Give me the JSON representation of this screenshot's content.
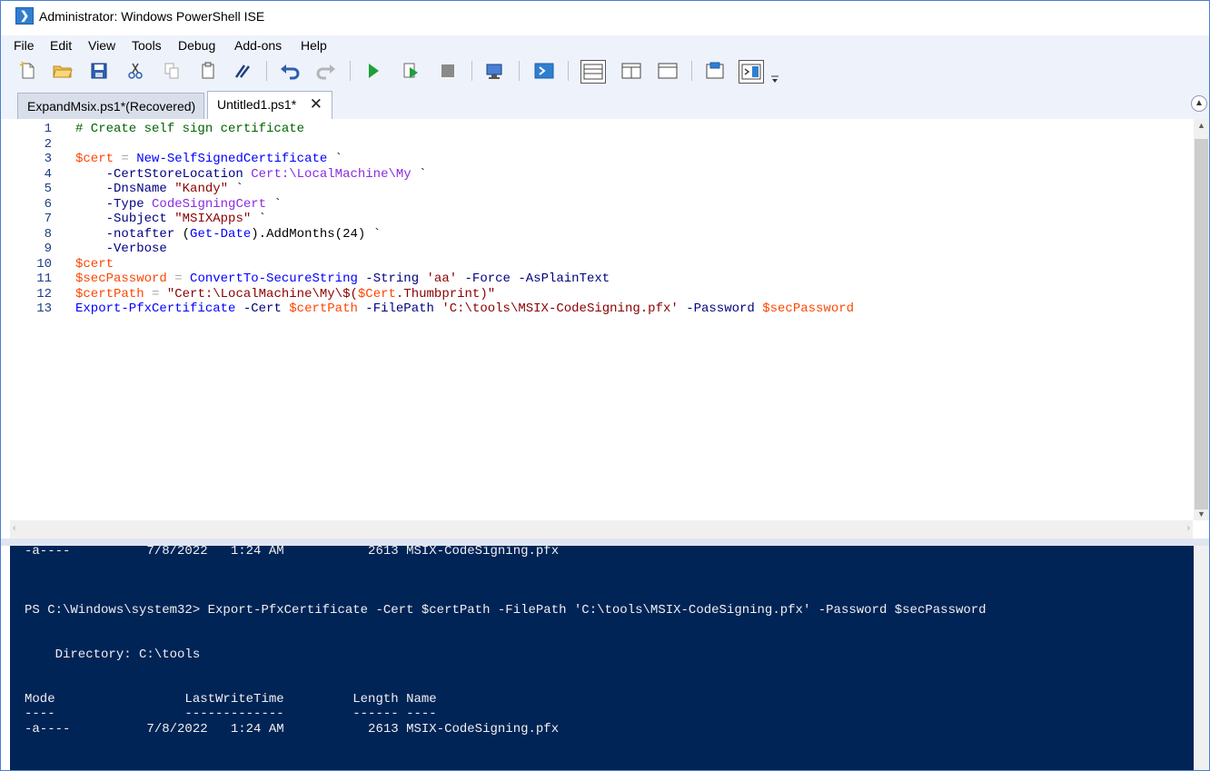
{
  "window": {
    "title": "Administrator: Windows PowerShell ISE",
    "icon_glyph": "❯"
  },
  "menu": [
    "File",
    "Edit",
    "View",
    "Tools",
    "Debug",
    "Add-ons",
    "Help"
  ],
  "toolbar": {
    "icons": [
      "new-file-icon",
      "open-folder-icon",
      "save-icon",
      "cut-icon",
      "copy-icon",
      "paste-icon",
      "clear-console-icon",
      "undo-icon",
      "redo-icon",
      "run-script-icon",
      "run-selection-icon",
      "stop-icon",
      "new-remote-tab-icon",
      "powershell-icon",
      "script-pane-top-icon",
      "script-pane-right-icon",
      "script-pane-maximized-icon",
      "show-script-pane-icon",
      "show-commands-icon",
      "toolbar-overflow-icon"
    ]
  },
  "tabs": [
    {
      "label": "ExpandMsix.ps1*(Recovered)",
      "active": false
    },
    {
      "label": "Untitled1.ps1*",
      "active": true
    }
  ],
  "editor": {
    "line_numbers": [
      "1",
      "2",
      "3",
      "4",
      "5",
      "6",
      "7",
      "8",
      "9",
      "10",
      "11",
      "12",
      "13"
    ],
    "lines": {
      "l1": {
        "comment": "# Create self sign certificate"
      },
      "l3": {
        "var": "$cert",
        "op": " = ",
        "cmd": "New-SelfSignedCertificate",
        "tick": " `"
      },
      "l4": {
        "indent": "    ",
        "param": "-CertStoreLocation",
        "sp": " ",
        "value": "Cert:\\LocalMachine\\My",
        "tick": " `"
      },
      "l5": {
        "indent": "    ",
        "param": "-DnsName",
        "sp": " ",
        "value": "\"Kandy\"",
        "tick": " `"
      },
      "l6": {
        "indent": "    ",
        "param": "-Type",
        "sp": " ",
        "value": "CodeSigningCert",
        "tick": " `"
      },
      "l7": {
        "indent": "    ",
        "param": "-Subject",
        "sp": " ",
        "value": "\"MSIXApps\"",
        "tick": " `"
      },
      "l8": {
        "indent": "    ",
        "param": "-notafter",
        "sp": " ",
        "p1": "(",
        "cmd": "Get-Date",
        "rest": ").AddMonths(24)",
        "tick": " `"
      },
      "l9": {
        "indent": "    ",
        "param": "-Verbose"
      },
      "l10": {
        "var": "$cert"
      },
      "l11": {
        "var": "$secPassword",
        "op": " = ",
        "cmd": "ConvertTo-SecureString",
        "sp1": " ",
        "param1": "-String",
        "sp2": " ",
        "str": "'aa'",
        "sp3": " ",
        "param2": "-Force",
        "sp4": " ",
        "param3": "-AsPlainText"
      },
      "l12": {
        "var": "$certPath",
        "op": " = ",
        "str_a": "\"Cert:\\LocalMachine\\My\\$(",
        "var2": "$Cert",
        "str_b": ".Thumbprint)\""
      },
      "l13": {
        "cmd": "Export-PfxCertificate",
        "sp1": " ",
        "param1": "-Cert",
        "sp2": " ",
        "var1": "$certPath",
        "sp3": " ",
        "param2": "-FilePath",
        "sp4": " ",
        "str": "'C:\\tools\\MSIX-CodeSigning.pfx'",
        "sp5": " ",
        "param3": "-Password",
        "sp6": " ",
        "var2": "$secPassword"
      }
    }
  },
  "console": {
    "lines": [
      "-a----          7/8/2022   1:24 AM           2613 MSIX-CodeSigning.pfx",
      "PS C:\\Windows\\system32> Export-PfxCertificate -Cert $certPath -FilePath 'C:\\tools\\MSIX-CodeSigning.pfx' -Password $secPassword",
      "    Directory: C:\\tools",
      "Mode                 LastWriteTime         Length Name",
      "----                 -------------         ------ ----",
      "-a----          7/8/2022   1:24 AM           2613 MSIX-CodeSigning.pfx"
    ]
  },
  "colors": {
    "console_bg": "#012456",
    "comment": "#006400",
    "variable": "#ff4500",
    "command": "#0000ff",
    "parameter": "#000080",
    "string": "#8b0000",
    "type": "#8a2be2"
  }
}
